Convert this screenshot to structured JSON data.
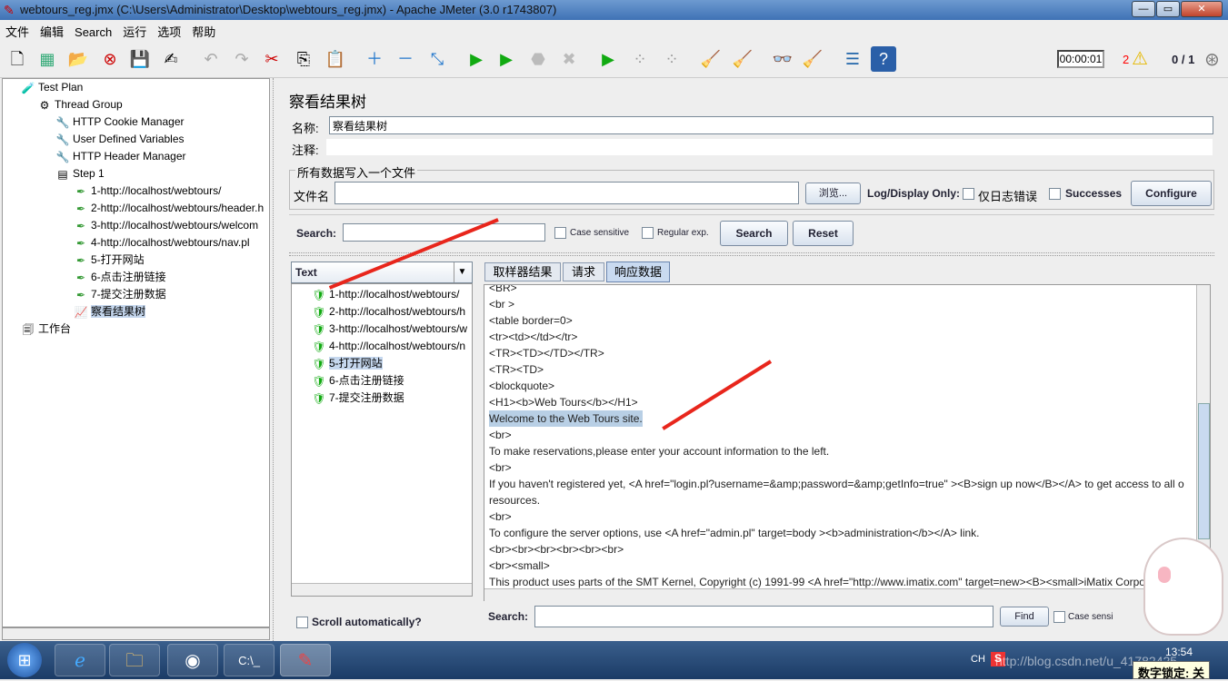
{
  "window": {
    "title": "webtours_reg.jmx (C:\\Users\\Administrator\\Desktop\\webtours_reg.jmx) - Apache JMeter (3.0 r1743807)"
  },
  "menu": [
    "文件",
    "编辑",
    "Search",
    "运行",
    "选项",
    "帮助"
  ],
  "status": {
    "timer": "00:00:01",
    "warnings": "2",
    "threads": "0 / 1",
    "warning_color": "#ff0000"
  },
  "tree": {
    "items": [
      {
        "label": "Test Plan",
        "icon": "test-plan-icon"
      },
      {
        "label": "Thread Group",
        "icon": "gear-icon"
      },
      {
        "label": "HTTP Cookie Manager",
        "icon": "wrench-icon"
      },
      {
        "label": "User Defined Variables",
        "icon": "wrench-icon"
      },
      {
        "label": "HTTP Header Manager",
        "icon": "wrench-icon"
      },
      {
        "label": "Step 1",
        "icon": "controller-icon"
      },
      {
        "label": "1-http://localhost/webtours/",
        "icon": "sampler-icon"
      },
      {
        "label": "2-http://localhost/webtours/header.h",
        "icon": "sampler-icon"
      },
      {
        "label": "3-http://localhost/webtours/welcom",
        "icon": "sampler-icon"
      },
      {
        "label": "4-http://localhost/webtours/nav.pl",
        "icon": "sampler-icon"
      },
      {
        "label": "5-打开网站",
        "icon": "sampler-icon"
      },
      {
        "label": "6-点击注册链接",
        "icon": "sampler-icon"
      },
      {
        "label": "7-提交注册数据",
        "icon": "sampler-icon"
      },
      {
        "label": "察看结果树",
        "icon": "listener-icon"
      },
      {
        "label": "工作台",
        "icon": "workbench-icon"
      }
    ]
  },
  "panel": {
    "title": "察看结果树",
    "name_label": "名称:",
    "name_value": "察看结果树",
    "comment_label": "注释:",
    "comment_value": "",
    "file_group": "所有数据写入一个文件",
    "file_label": "文件名",
    "file_value": "",
    "browse": "浏览...",
    "log_only": "Log/Display Only:",
    "errors_only": "仅日志错误",
    "successes": "Successes",
    "configure": "Configure",
    "search_label": "Search:",
    "search_value": "",
    "case_sensitive": "Case sensitive",
    "regex": "Regular exp.",
    "search_btn": "Search",
    "reset_btn": "Reset"
  },
  "results": {
    "renderer": "Text",
    "items": [
      "1-http://localhost/webtours/",
      "2-http://localhost/webtours/h",
      "3-http://localhost/webtours/w",
      "4-http://localhost/webtours/n",
      "5-打开网站",
      "6-点击注册链接",
      "7-提交注册数据"
    ],
    "selected": 4,
    "scroll_auto": "Scroll automatically?"
  },
  "tabs": [
    "取样器结果",
    "请求",
    "响应数据"
  ],
  "active_tab": 2,
  "response_lines": [
    "<BR>",
    "<br >",
    "<table border=0>",
    "<tr><td></td></tr>",
    "<TR><TD></TD></TR>",
    "<TR><TD>",
    "<blockquote>",
    "<H1><b>Web Tours</b></H1>",
    "Welcome to the Web Tours site.",
    "<br>",
    "To make reservations,please enter your account information to the left.",
    "<br>",
    "If you haven't registered yet, <A href=\"login.pl?username=&amp;password=&amp;getInfo=true\" ><B>sign up now</B></A> to get access to all o",
    " resources.",
    "<br>",
    "To configure the server options, use <A href=\"admin.pl\" target=body ><b>administration</b></A> link.",
    "<br><br><br><br><br><br>",
    "<br><small>",
    "This product uses parts of the SMT Kernel, Copyright (c) 1991-99 <A href=\"http://www.imatix.com\" target=new><B><small>iMatix Corpor"
  ],
  "highlighted_line": 8,
  "find": {
    "label": "Search:",
    "value": "",
    "button": "Find",
    "case_sensitive": "Case sensi"
  },
  "taskbar": {
    "lang": "CH",
    "clock": "13:54",
    "watermark": "http://blog.csdn.net/u_41782425",
    "numlock_tooltip": "数字锁定: 关"
  }
}
